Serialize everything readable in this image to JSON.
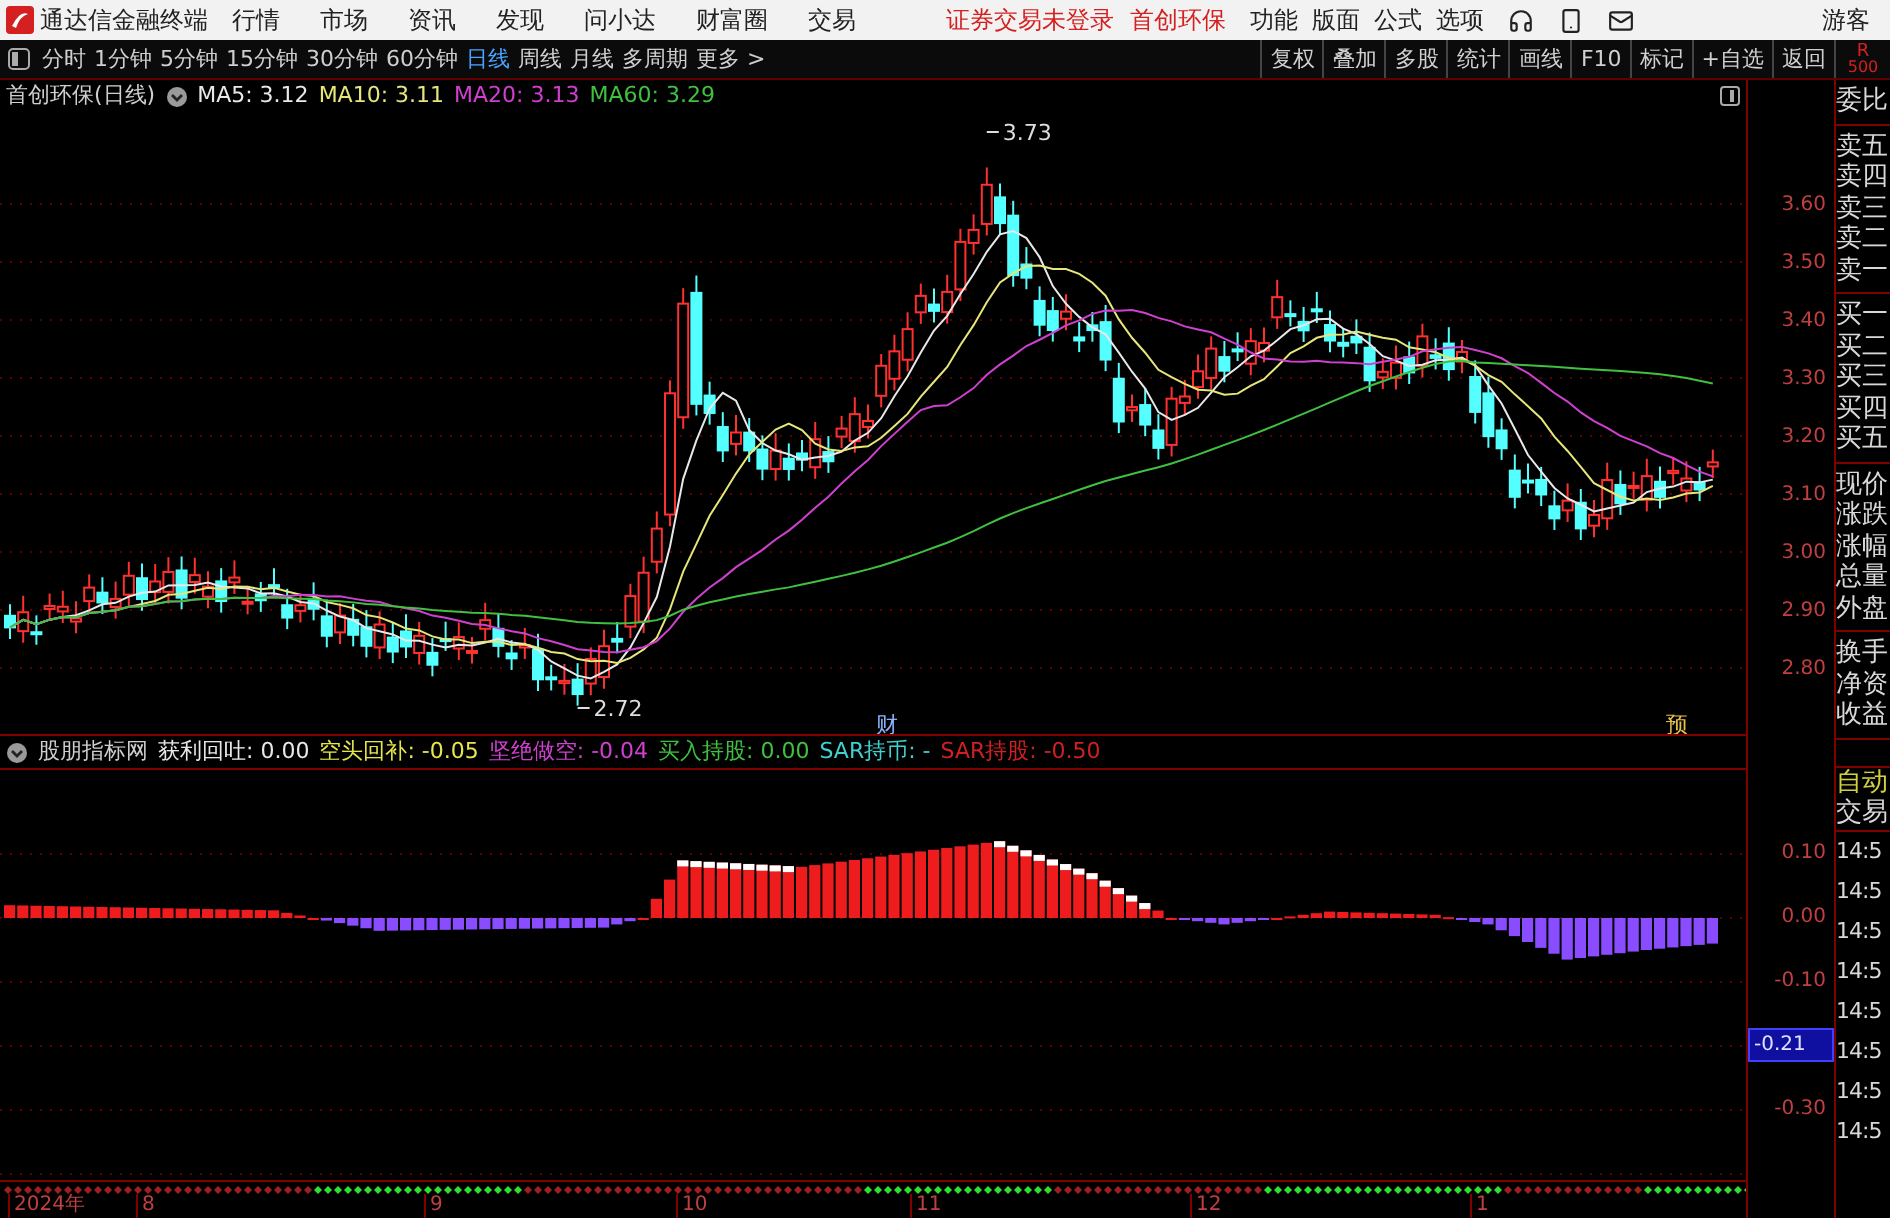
{
  "title_bar": {
    "app_title": "通达信金融终端",
    "menu": [
      "行情",
      "市场",
      "资讯",
      "发现",
      "问小达",
      "财富圈",
      "交易"
    ],
    "login_status": "证券交易未登录",
    "stock_name": "首创环保",
    "right_menu": [
      "功能",
      "版面",
      "公式",
      "选项"
    ],
    "user": "游客"
  },
  "toolbar": {
    "periods": [
      {
        "label": "分时",
        "selected": false
      },
      {
        "label": "1分钟",
        "selected": false
      },
      {
        "label": "5分钟",
        "selected": false
      },
      {
        "label": "15分钟",
        "selected": false
      },
      {
        "label": "30分钟",
        "selected": false
      },
      {
        "label": "60分钟",
        "selected": false
      },
      {
        "label": "日线",
        "selected": true
      },
      {
        "label": "周线",
        "selected": false
      },
      {
        "label": "月线",
        "selected": false
      },
      {
        "label": "多周期",
        "selected": false
      },
      {
        "label": "更多 >",
        "selected": false
      }
    ],
    "buttons": [
      "复权",
      "叠加",
      "多股",
      "统计",
      "画线",
      "F10",
      "标记",
      "+自选",
      "返回"
    ]
  },
  "corner": {
    "label": "R",
    "value": "500"
  },
  "price_chart": {
    "title": "首创环保(日线)",
    "ma": [
      {
        "label": "MA5: 3.12",
        "color": "#e8e8e8"
      },
      {
        "label": "MA10: 3.11",
        "color": "#e6e67a"
      },
      {
        "label": "MA20: 3.13",
        "color": "#d040d0"
      },
      {
        "label": "MA60: 3.29",
        "color": "#40c040"
      }
    ],
    "high_label": "3.73",
    "low_label": "2.72",
    "markers": [
      "财",
      "预"
    ],
    "y_ticks": [
      "3.60",
      "3.50",
      "3.40",
      "3.30",
      "3.20",
      "3.10",
      "3.00",
      "2.90",
      "2.80"
    ]
  },
  "indicator": {
    "source": "股朋指标网",
    "items": [
      {
        "label": "获利回吐: 0.00",
        "color": "#e8e8e8"
      },
      {
        "label": "空头回补: -0.05",
        "color": "#e6e64a"
      },
      {
        "label": "坚绝做空: -0.04",
        "color": "#d040d0"
      },
      {
        "label": "买入持股: 0.00",
        "color": "#40c040"
      },
      {
        "label": "SAR持币: -",
        "color": "#40d0d0"
      },
      {
        "label": "SAR持股: -0.50",
        "color": "#d02020"
      }
    ],
    "y_axis": [
      {
        "label": "0.10",
        "kind": "tick"
      },
      {
        "label": "0.00",
        "kind": "tick"
      },
      {
        "label": "-0.10",
        "kind": "tick"
      },
      {
        "label": "-0.21",
        "kind": "current"
      },
      {
        "label": "-0.30",
        "kind": "tick"
      }
    ]
  },
  "date_axis": [
    "2024年",
    "8",
    "9",
    "10",
    "11",
    "12",
    "1"
  ],
  "quote_panel": {
    "groups": [
      [
        "委比"
      ],
      [
        "卖五",
        "卖四",
        "卖三",
        "卖二",
        "卖一"
      ],
      [
        "买一",
        "买二",
        "买三",
        "买四",
        "买五"
      ],
      [
        "现价",
        "涨跌",
        "涨幅",
        "总量",
        "外盘"
      ],
      [
        "换手",
        "净资",
        "收益"
      ]
    ],
    "auto": "自动",
    "trade": "交易",
    "times": [
      "14:5",
      "14:5",
      "14:5",
      "14:5",
      "14:5",
      "14:5",
      "14:5",
      "14:5"
    ]
  }
}
